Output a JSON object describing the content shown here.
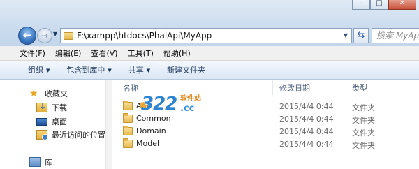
{
  "window": {
    "minimize_glyph": "–",
    "maximize_glyph": "□",
    "close_glyph": "✕"
  },
  "nav": {
    "back_glyph": "←",
    "forward_glyph": "→",
    "history_glyph": "▼",
    "address": "F:\\xampp\\htdocs\\PhalApi\\MyApp",
    "address_dropdown_glyph": "▼",
    "refresh_glyph": "⇆",
    "search_placeholder": "搜索 MyApp"
  },
  "menu": {
    "items": [
      "文件(F)",
      "编辑(E)",
      "查看(V)",
      "工具(T)",
      "帮助(H)"
    ]
  },
  "commands": {
    "items": [
      {
        "label": "组织",
        "caret": "▼"
      },
      {
        "label": "包含到库中",
        "caret": "▼"
      },
      {
        "label": "共享",
        "caret": "▼"
      },
      {
        "label": "新建文件夹",
        "caret": ""
      }
    ]
  },
  "sidebar": {
    "items": [
      {
        "label": "收藏夹",
        "icon": "star-icon"
      },
      {
        "label": "下载",
        "icon": "downloads-folder-icon"
      },
      {
        "label": "桌面",
        "icon": "desktop-icon"
      },
      {
        "label": "最近访问的位置",
        "icon": "recent-places-icon"
      },
      {
        "label": "库",
        "icon": "library-icon"
      }
    ],
    "star_glyph": "★"
  },
  "filelist": {
    "columns": {
      "name": "名称",
      "date": "修改日期",
      "type": "类型"
    },
    "rows": [
      {
        "name": "Api",
        "date": "2015/4/4 0:44",
        "type": "文件夹"
      },
      {
        "name": "Common",
        "date": "2015/4/4 0:44",
        "type": "文件夹"
      },
      {
        "name": "Domain",
        "date": "2015/4/4 0:44",
        "type": "文件夹"
      },
      {
        "name": "Model",
        "date": "2015/4/4 0:44",
        "type": "文件夹"
      }
    ]
  },
  "watermark": {
    "number": "322",
    "suffix": ".cc",
    "subtitle": "软件站"
  }
}
